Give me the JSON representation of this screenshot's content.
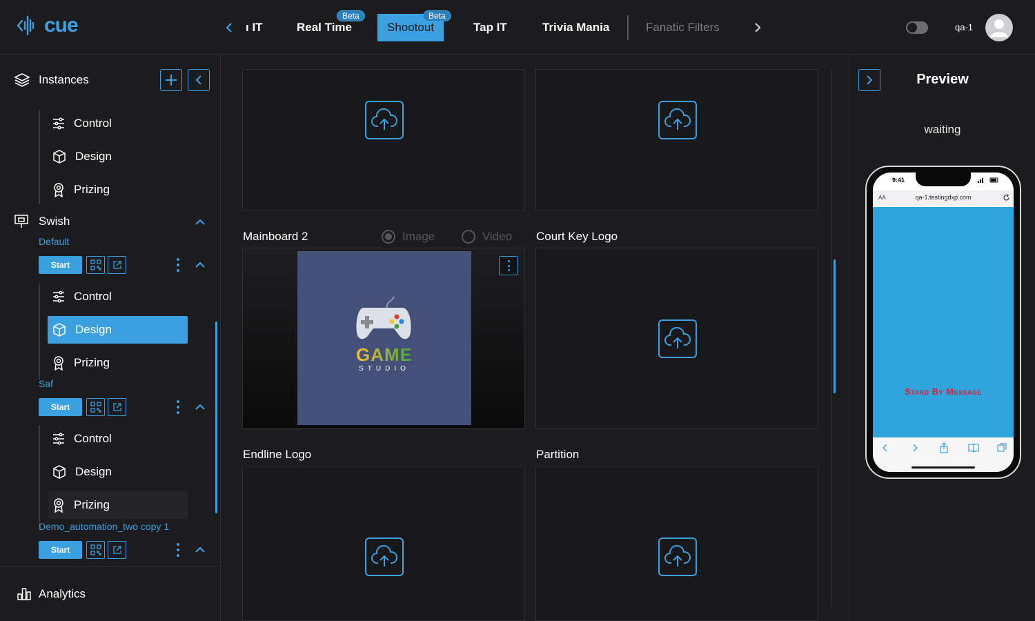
{
  "app": {
    "logo_text": "cue",
    "username": "qa-1"
  },
  "nav": {
    "items": [
      {
        "label": "ı IT",
        "state": "partial"
      },
      {
        "label": "Real Time",
        "badge": "Beta"
      },
      {
        "label": "Shootout",
        "badge": "Beta",
        "state": "active"
      },
      {
        "label": "Tap IT"
      },
      {
        "label": "Trivia Mania"
      },
      {
        "label": "Fanatic Filters",
        "state": "disabled"
      }
    ]
  },
  "sidebar": {
    "header": "Instances",
    "top_items": [
      {
        "label": "Control",
        "icon": "sliders-icon"
      },
      {
        "label": "Design",
        "icon": "cube-icon"
      },
      {
        "label": "Prizing",
        "icon": "award-icon"
      }
    ],
    "section": "Swish",
    "instances": [
      {
        "name": "Default",
        "start_label": "Start",
        "items": [
          {
            "label": "Control",
            "icon": "sliders-icon"
          },
          {
            "label": "Design",
            "icon": "cube-icon",
            "active": true
          },
          {
            "label": "Prizing",
            "icon": "award-icon"
          }
        ]
      },
      {
        "name": "Saf",
        "start_label": "Start",
        "items": [
          {
            "label": "Control",
            "icon": "sliders-icon"
          },
          {
            "label": "Design",
            "icon": "cube-icon"
          },
          {
            "label": "Prizing",
            "icon": "award-icon"
          }
        ]
      },
      {
        "name": "Demo_automation_two copy 1",
        "start_label": "Start"
      }
    ],
    "analytics_label": "Analytics"
  },
  "main": {
    "panels": [
      {
        "label": ""
      },
      {
        "label": ""
      },
      {
        "label": "Mainboard 2",
        "radio_image": "Image",
        "radio_video": "Video",
        "image_text_1": "GAME",
        "image_text_2": "STUDIO"
      },
      {
        "label": "Court Key Logo"
      },
      {
        "label": "Endline Logo"
      },
      {
        "label": "Partition"
      }
    ]
  },
  "preview": {
    "title": "Preview",
    "status": "waiting",
    "phone_time": "9:41",
    "url_aa": "AA",
    "url": "qa-1.testingdxp.com",
    "standby": "Stand By Message"
  },
  "colors": {
    "accent": "#3aa0e0",
    "background": "#1c1c1f",
    "panel": "#18181b",
    "standby_text": "#e0203a",
    "phone_app_bg": "#2fa3dc"
  }
}
